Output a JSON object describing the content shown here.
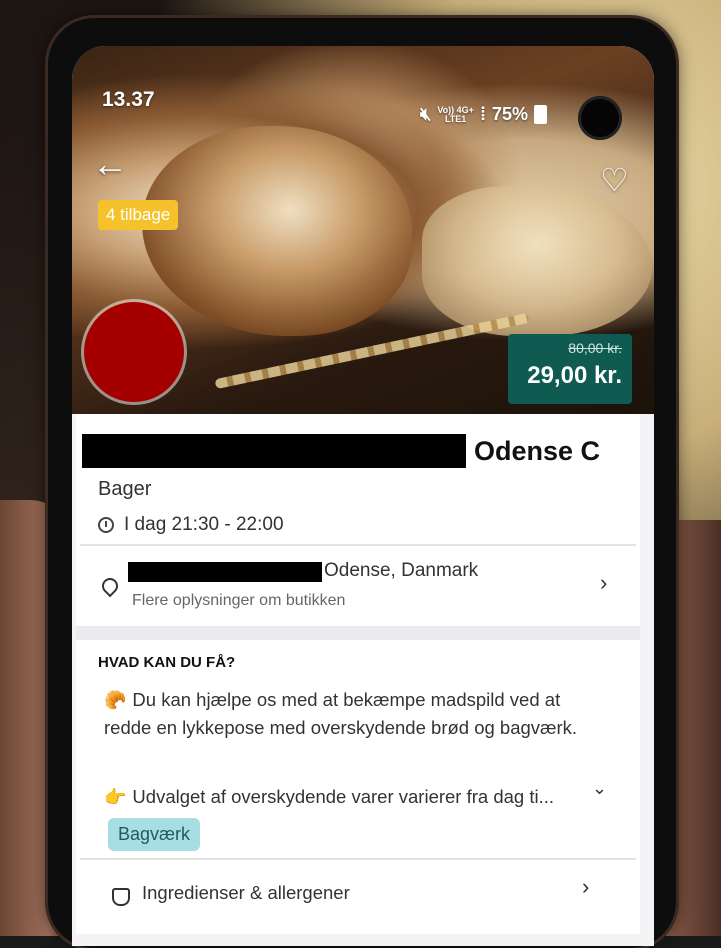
{
  "status_bar": {
    "time": "13.37",
    "network_top": "Vo)) 4G+",
    "network_bottom": "LTE1",
    "battery": "75%"
  },
  "hero": {
    "items_left_badge": "4 tilbage",
    "price_old": "80,00 kr.",
    "price_new": "29,00 kr."
  },
  "store": {
    "name_suffix": "Odense C",
    "category": "Bager",
    "pickup_time": "I dag 21:30 - 22:00",
    "address_city": "Odense, Danmark",
    "more_info": "Flere oplysninger om butikken"
  },
  "details": {
    "section_title": "HVAD KAN DU FÅ?",
    "description": "Du kan hjælpe os med at bekæmpe madspild ved at redde en lykkepose med overskydende brød og bagværk.",
    "note": "Udvalget af overskydende varer varierer fra dag ti...",
    "tag": "Bagværk",
    "ingredients_label": "Ingredienser & allergener"
  },
  "colors": {
    "price_bg": "#0f5b52",
    "badge_bg": "#f6c22b",
    "tag_bg": "#a8dde3",
    "logo": "#a50000"
  }
}
